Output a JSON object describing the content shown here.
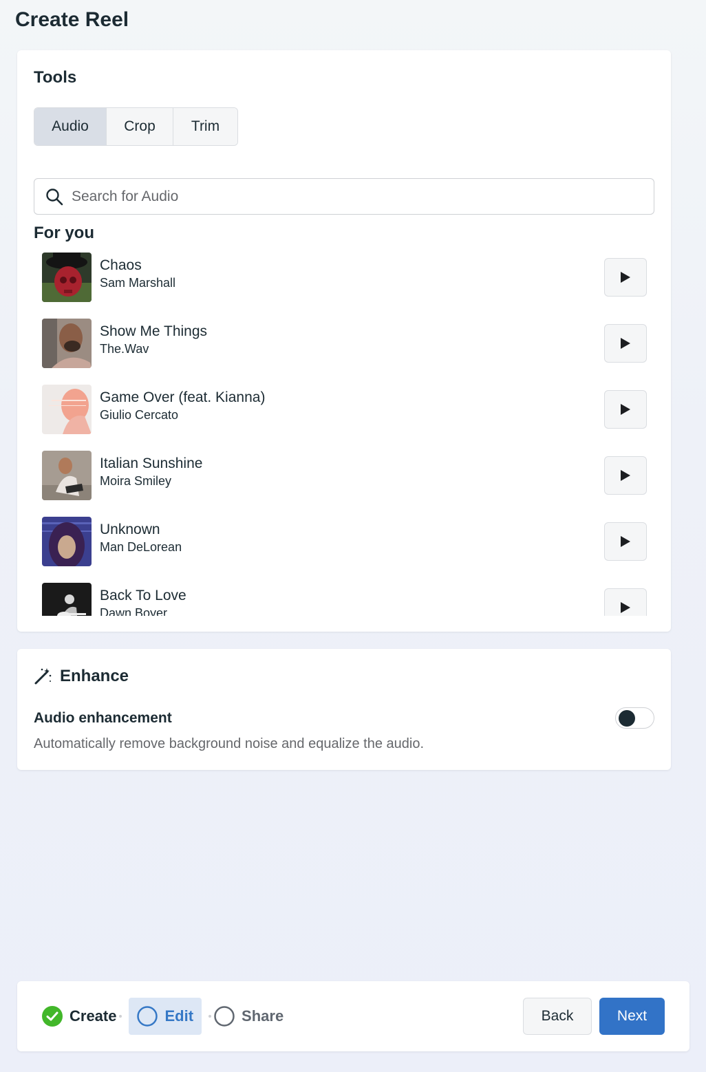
{
  "page": {
    "title": "Create Reel"
  },
  "tools": {
    "title": "Tools",
    "tabs": [
      {
        "label": "Audio",
        "active": true
      },
      {
        "label": "Crop",
        "active": false
      },
      {
        "label": "Trim",
        "active": false
      }
    ],
    "search": {
      "placeholder": "Search for Audio",
      "value": ""
    },
    "section_label": "For you",
    "tracks": [
      {
        "title": "Chaos",
        "artist": "Sam Marshall",
        "thumb_icon": "album-art-red-skull"
      },
      {
        "title": "Show Me Things",
        "artist": "The.Wav",
        "thumb_icon": "album-art-portrait-man"
      },
      {
        "title": "Game Over (feat. Kianna)",
        "artist": "Giulio Cercato",
        "thumb_icon": "album-art-pink-silhouette"
      },
      {
        "title": "Italian Sunshine",
        "artist": "Moira Smiley",
        "thumb_icon": "album-art-woman-rocks"
      },
      {
        "title": "Unknown",
        "artist": "Man DeLorean",
        "thumb_icon": "album-art-purple-hood"
      },
      {
        "title": "Back To Love",
        "artist": "Dawn Boyer",
        "thumb_icon": "album-art-guitarist-bw"
      }
    ]
  },
  "enhance": {
    "title": "Enhance",
    "icon": "magic-wand-icon",
    "setting_label": "Audio enhancement",
    "setting_description": "Automatically remove background noise and equalize the audio.",
    "toggle_on": false
  },
  "footer": {
    "steps": [
      {
        "label": "Create",
        "state": "complete"
      },
      {
        "label": "Edit",
        "state": "current"
      },
      {
        "label": "Share",
        "state": "upcoming"
      }
    ],
    "back_label": "Back",
    "next_label": "Next"
  },
  "colors": {
    "primary": "#3273c7",
    "success": "#42b72a",
    "text": "#1c2b33",
    "secondary_text": "#65676b"
  }
}
